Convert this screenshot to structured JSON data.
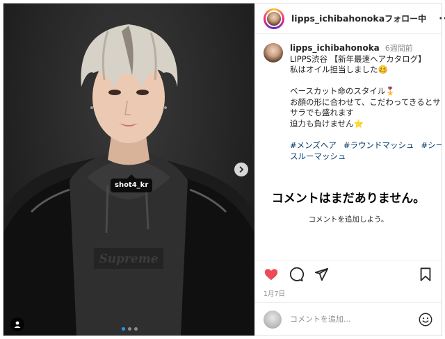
{
  "post": {
    "image_tag": "shot4_kr",
    "image_logo_text": "Supreme",
    "carousel": {
      "count": 3,
      "active_index": 0
    }
  },
  "header": {
    "username": "lipps_ichibahonoka",
    "follow_label": "フォロー中",
    "more_label": "···"
  },
  "caption": {
    "username": "lipps_ichibahonoka",
    "time": "6週間前",
    "lines": [
      "LIPPS渋谷 【新年最速ヘアカタログ】",
      "私はオイル担当しました🥴",
      "",
      "ベースカット命のスタイル🎖️",
      "お顔の形に合わせて、こだわってきるとサラ",
      "サラでも盛れます",
      "迫力も負けません⭐"
    ],
    "hashtags": [
      "#メンズヘア",
      "#ラウンドマッシュ",
      "#シースルーマッシュ"
    ]
  },
  "comments": {
    "empty_title": "コメントはまだありません。",
    "empty_subtitle": "コメントを追加しよう。"
  },
  "actions": {
    "liked": true,
    "like_color": "#ed4956",
    "icons": [
      "heart-icon",
      "comment-icon",
      "share-icon",
      "bookmark-icon"
    ]
  },
  "date": "1月7日",
  "comment_input": {
    "placeholder": "コメントを追加...",
    "value": ""
  }
}
